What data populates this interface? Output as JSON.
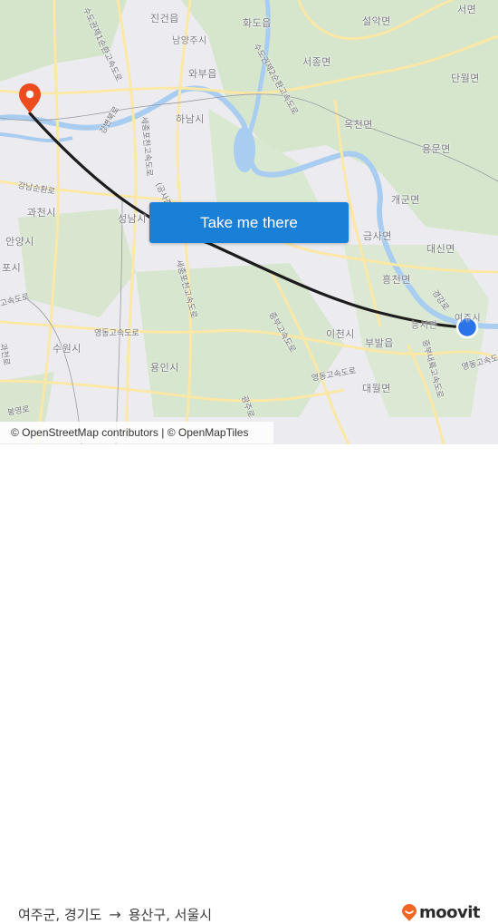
{
  "map": {
    "places": [
      {
        "name": "진건읍"
      },
      {
        "name": "화도읍"
      },
      {
        "name": "설악면"
      },
      {
        "name": "서면"
      },
      {
        "name": "남양주시"
      },
      {
        "name": "와부읍"
      },
      {
        "name": "서종면"
      },
      {
        "name": "단월면"
      },
      {
        "name": "하남시"
      },
      {
        "name": "옥천면"
      },
      {
        "name": "용문면"
      },
      {
        "name": "개군면"
      },
      {
        "name": "과천시"
      },
      {
        "name": "성남시"
      },
      {
        "name": "금사면"
      },
      {
        "name": "대신면"
      },
      {
        "name": "안양시"
      },
      {
        "name": "포시"
      },
      {
        "name": "흥천면"
      },
      {
        "name": "여주시"
      },
      {
        "name": "능서면"
      },
      {
        "name": "이천시"
      },
      {
        "name": "부발읍"
      },
      {
        "name": "수원시"
      },
      {
        "name": "용인시"
      },
      {
        "name": "대월면"
      }
    ],
    "roads": [
      {
        "name": "수도권제1순환고속도로"
      },
      {
        "name": "수도권제2순환고속도로"
      },
      {
        "name": "세종포천고속도로"
      },
      {
        "name": "세종포천고속도로"
      },
      {
        "name": "강남순환로"
      },
      {
        "name": "(공사중)"
      },
      {
        "name": "영동고속도로"
      },
      {
        "name": "영동고속도로"
      },
      {
        "name": "영동고속도로"
      },
      {
        "name": "중부내륙고속도로"
      },
      {
        "name": "중부고속도로"
      },
      {
        "name": "강변북로"
      },
      {
        "name": "과천로"
      },
      {
        "name": "봉영로"
      },
      {
        "name": "경강로"
      },
      {
        "name": "광주로"
      },
      {
        "name": "고속도로"
      }
    ],
    "origin_marker": "orange-pin-icon",
    "destination_marker": "blue-dot-icon",
    "colors": {
      "origin": "#ee4b1f",
      "destination": "#2a73e8",
      "route": "#1c1c1c",
      "button": "#1a7fd6"
    }
  },
  "cta": {
    "label": "Take me there"
  },
  "attribution": "© OpenStreetMap contributors | © OpenMapTiles",
  "footer": {
    "from": "여주군, 경기도",
    "arrow": "→",
    "to": "용산구, 서울시",
    "brand": "moovit",
    "brand_color": "#f26522"
  }
}
